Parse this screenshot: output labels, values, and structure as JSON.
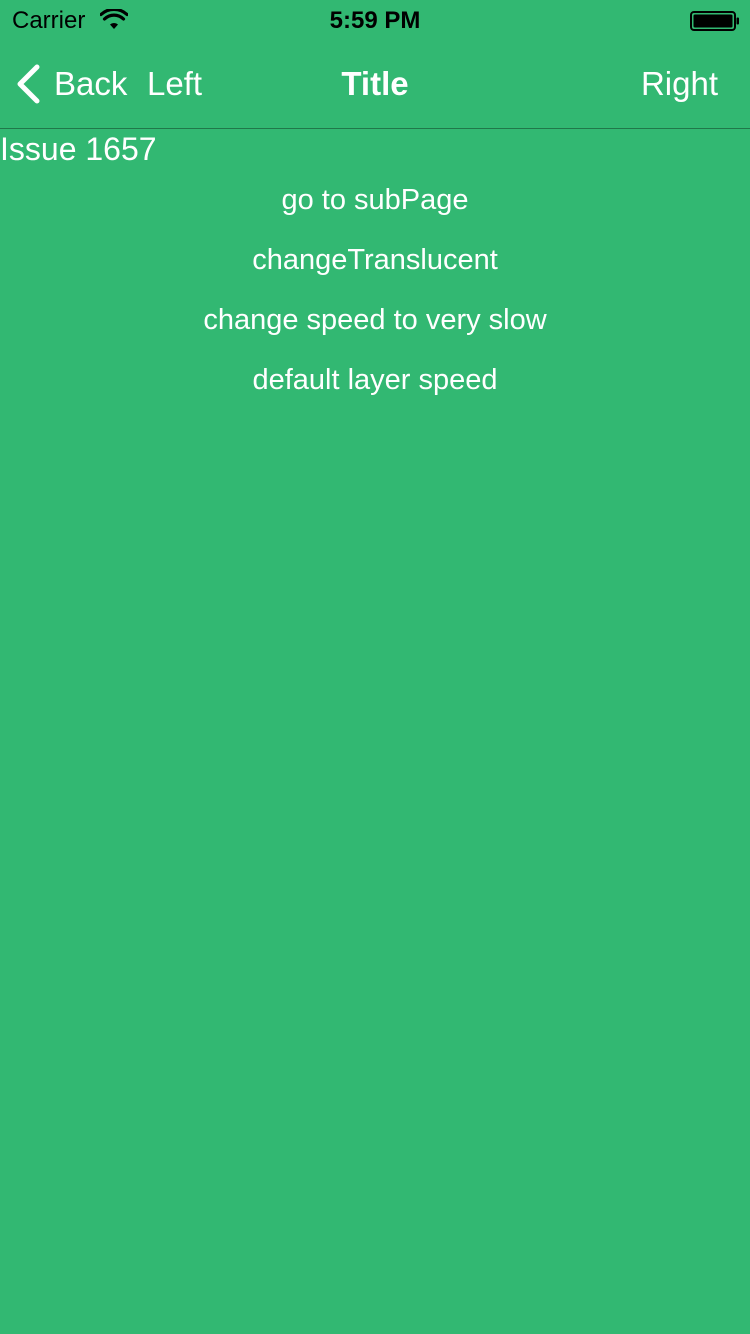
{
  "status_bar": {
    "carrier": "Carrier",
    "time": "5:59 PM",
    "wifi_icon": "wifi-icon",
    "battery_icon": "battery-icon"
  },
  "nav": {
    "back_label": "Back",
    "left_label": "Left",
    "title": "Title",
    "right_label": "Right",
    "back_icon": "chevron-left-icon"
  },
  "content": {
    "issue_label": "Issue 1657",
    "actions": [
      {
        "label": "go to subPage"
      },
      {
        "label": "changeTranslucent"
      },
      {
        "label": "change speed to very slow"
      },
      {
        "label": "default layer speed"
      }
    ]
  },
  "colors": {
    "background": "#32b872",
    "text": "#ffffff",
    "status_text": "#000000"
  }
}
